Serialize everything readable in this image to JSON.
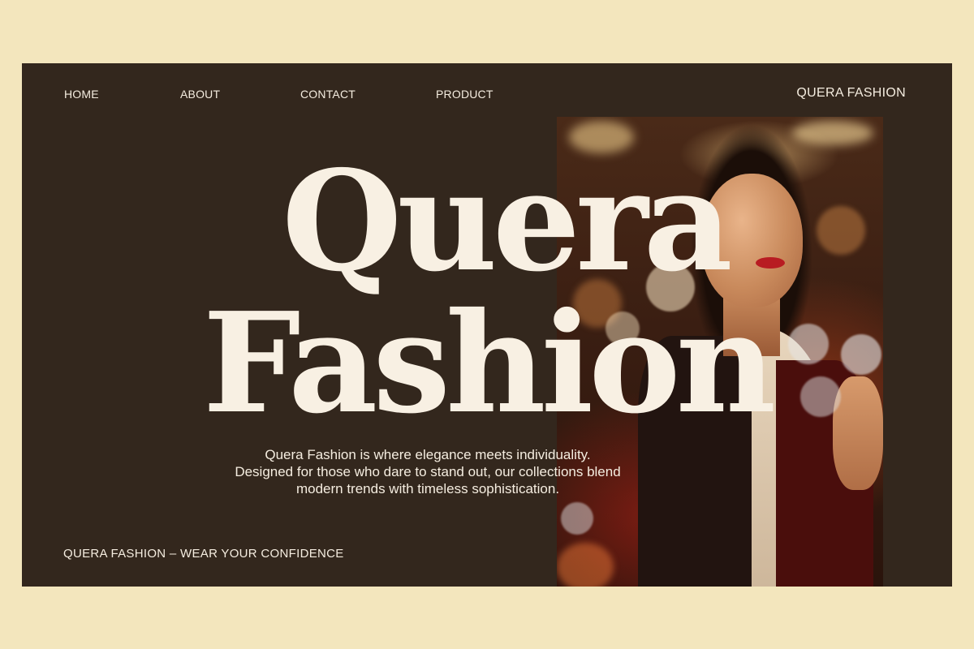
{
  "nav": {
    "items": [
      {
        "label": "HOME"
      },
      {
        "label": "ABOUT"
      },
      {
        "label": "CONTACT"
      },
      {
        "label": "PRODUCT"
      }
    ]
  },
  "brand": "QUERA FASHION",
  "hero": {
    "line1": "Quera",
    "line2": "Fashion"
  },
  "tagline": {
    "line1": "Quera Fashion is where elegance meets individuality.",
    "line2": "Designed for those who dare to stand out, our collections blend",
    "line3": "modern trends with timeless sophistication."
  },
  "footer": "QUERA FASHION – WEAR YOUR CONFIDENCE",
  "colors": {
    "page_background": "#f3e6bd",
    "panel_background": "#33271d",
    "text": "#f5ede0"
  }
}
